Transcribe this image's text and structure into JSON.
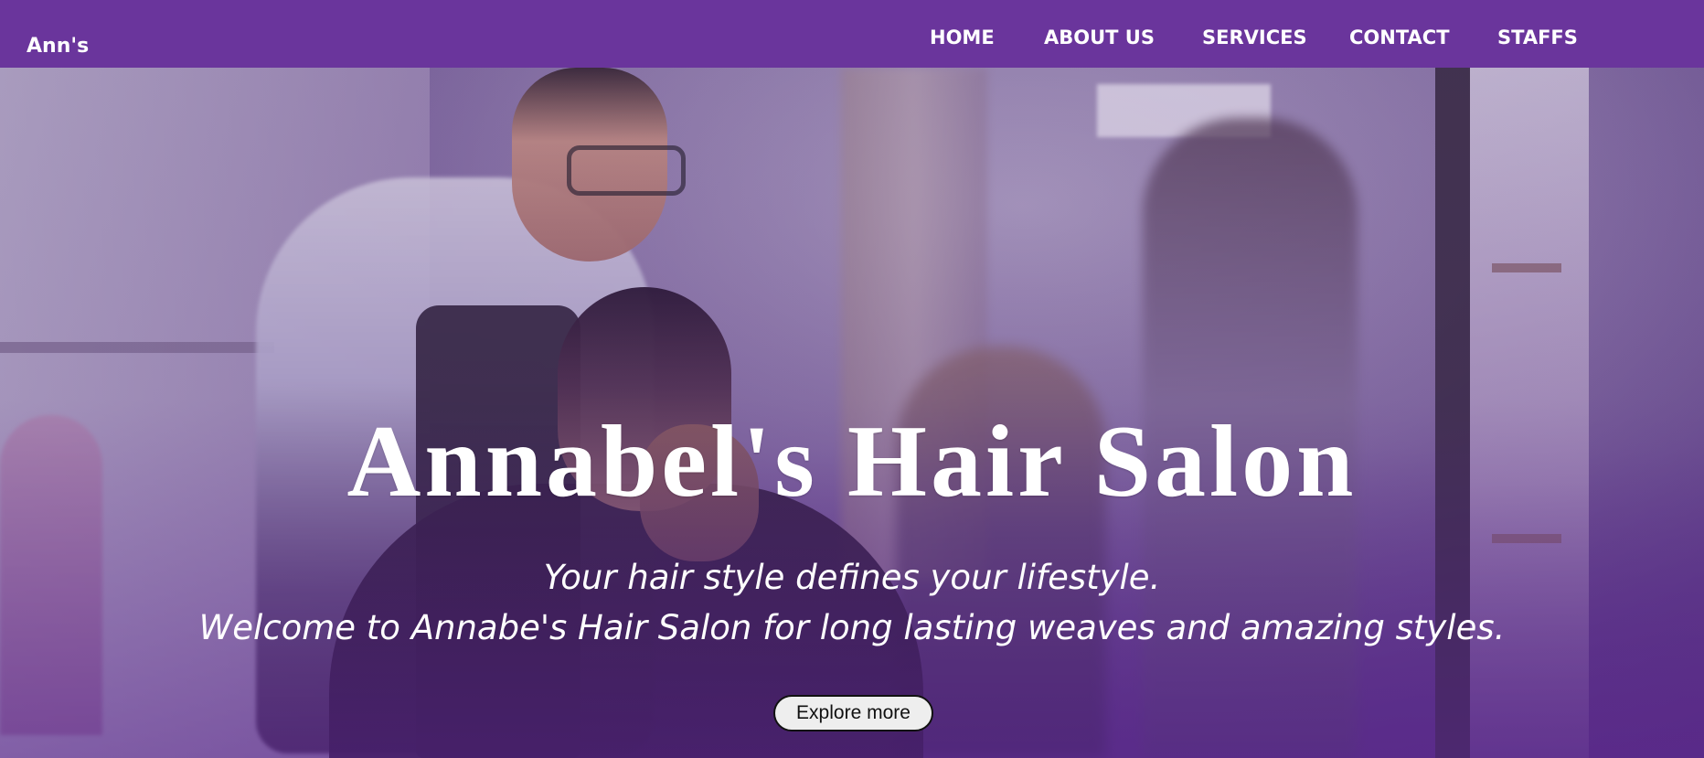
{
  "navbar": {
    "brand": "Ann's",
    "links": [
      {
        "label": "HOME"
      },
      {
        "label": "ABOUT US"
      },
      {
        "label": "SERVICES"
      },
      {
        "label": "CONTACT"
      },
      {
        "label": "STAFFS"
      }
    ],
    "background_color": "#6a359c",
    "text_color": "#ffffff"
  },
  "hero": {
    "title": "Annabel's Hair Salon",
    "tagline_line_1": "Your hair style defines your lifestyle.",
    "tagline_line_2": "Welcome to Annabe's Hair Salon for long lasting weaves and amazing styles.",
    "button_label": "Explore more",
    "overlay_color": "#6a359c",
    "text_color": "#ffffff"
  },
  "button": {
    "background_color": "#eeeeee",
    "border_color": "#111111",
    "text_color": "#111111"
  }
}
